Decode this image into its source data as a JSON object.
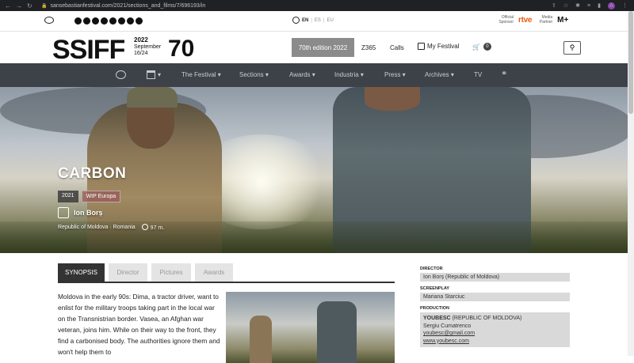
{
  "browser": {
    "url": "sansebastianfestival.com/2021/sections_and_films/7/696193/in",
    "avatar": "A"
  },
  "utility": {
    "langs": [
      "EN",
      "ES",
      "EU"
    ],
    "official_sponsor": "Official Sponsor",
    "media_partner": "Media Partner",
    "rtve": "rtve",
    "movistar": "M+"
  },
  "header": {
    "logo": "SSIFF",
    "year": "2022",
    "dates": "September",
    "days": "16/24",
    "seventy": "70",
    "edition_button": "70th edition 2022",
    "z365": "Z365",
    "calls": "Calls",
    "my_festival": "My Festival",
    "cart_count": "0"
  },
  "nav": {
    "items": [
      "The Festival",
      "Sections",
      "Awards",
      "Industria",
      "Press",
      "Archives",
      "TV"
    ]
  },
  "film": {
    "title": "CARBON",
    "year": "2021",
    "section": "WIP Europa",
    "director": "Ion Borș",
    "country": "Republic of Moldova · Romania",
    "duration": "97 m."
  },
  "tabs": [
    "SYNOPSIS",
    "Director",
    "Pictures",
    "Awards"
  ],
  "synopsis": "Moldova in the early 90s: Dima, a tractor driver, want to enlist for the military troops taking part in the local war on the Transnistrian border. Vasea, an Afghan war veteran, joins him. While on their way to the front, they find a carbonised body. The authorities ignore them and won't help them to",
  "credits": {
    "director_label": "DIRECTOR",
    "director_value": "Ion Borș (Republic of Moldova)",
    "screenplay_label": "SCREENPLAY",
    "screenplay_value": "Mariana Starciuc",
    "production_label": "PRODUCTION",
    "production_company": "YOUBESC",
    "production_country": "(REPUBLIC OF MOLDOVA)",
    "production_person": "Sergiu Cumatrenco",
    "production_email": "youbesc@gmail.com",
    "production_web": "www.youbesc.com"
  }
}
